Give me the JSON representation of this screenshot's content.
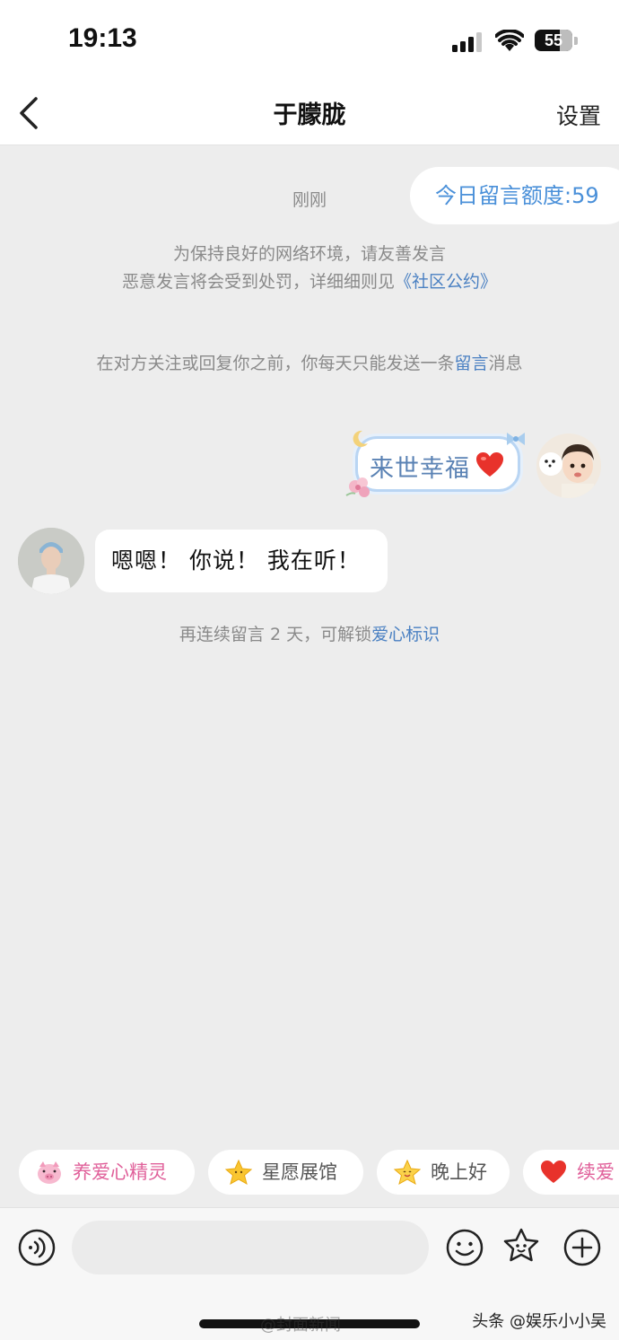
{
  "status_bar": {
    "time": "19:13",
    "battery": "55",
    "icons": [
      "cellular-signal-icon",
      "wifi-icon",
      "battery-icon"
    ]
  },
  "nav": {
    "back_icon": "chevron-left-icon",
    "title": "于朦胧",
    "settings_label": "设置"
  },
  "quota": {
    "label": "今日留言额度:59"
  },
  "chat": {
    "timestamp": "刚刚",
    "notice_line1": "为保持良好的网络环境，请友善发言",
    "notice_line2_prefix": "恶意发言将会受到处罚，详细细则见",
    "notice_line2_link": "《社区公约》",
    "limit_prefix": "在对方关注或回复你之前，你每天只能发送一条",
    "limit_link": "留言",
    "limit_suffix": "消息",
    "sent_sticker_text": "来世幸福",
    "sent_sticker_icon": "red-heart-icon",
    "reply_text": "嗯嗯！ 你说！ 我在听！",
    "streak_prefix": "再连续留言 2 天，可解锁",
    "streak_link": "爱心标识"
  },
  "quick_replies": [
    {
      "label": "养爱心精灵",
      "icon": "pink-pig-icon"
    },
    {
      "label": "星愿展馆",
      "icon": "yellow-star-icon"
    },
    {
      "label": "晚上好",
      "icon": "smiling-star-icon"
    },
    {
      "label": "续爱",
      "icon": "red-heart-icon"
    }
  ],
  "input": {
    "placeholder": "",
    "icons": [
      "voice-icon",
      "emoji-icon",
      "star-icon",
      "plus-icon"
    ]
  },
  "watermarks": {
    "center": "@封面新闻",
    "right": "头条 @娱乐小小吴"
  },
  "colors": {
    "background": "#ededed",
    "link_blue": "#4a80c2",
    "quota_blue": "#4a90d9",
    "pink": "#e0609a"
  }
}
